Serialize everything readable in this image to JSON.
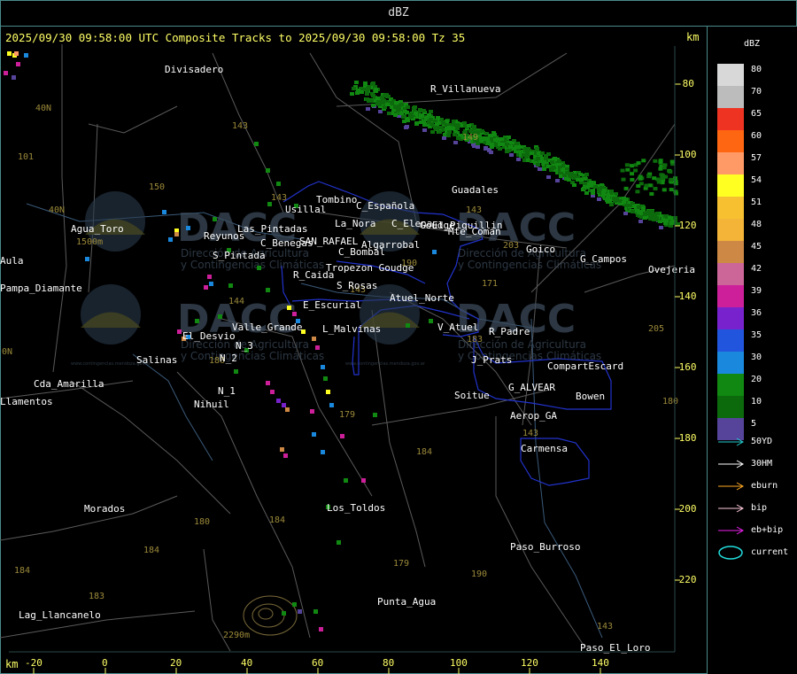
{
  "window": {
    "title": "dBZ"
  },
  "map": {
    "title": "2025/09/30 09:58:00 UTC Composite Tracks to 2025/09/30 09:58:00 Tz 35",
    "unit_top": "km",
    "unit_bottom": "km",
    "x_ticks": [
      "-20",
      "0",
      "20",
      "40",
      "60",
      "80",
      "100",
      "120",
      "140"
    ],
    "y_ticks": [
      "-80",
      "-100",
      "-120",
      "-140",
      "-160",
      "-180",
      "-200",
      "-220"
    ],
    "places": [
      "Divisadero",
      "R_Villanueva",
      "Guadales",
      "Tombino",
      "Usillal",
      "C_Española",
      "La_Nora",
      "C_Elena",
      "Goudge",
      "El_Piquillin",
      "Mte_Coman",
      "Goico",
      "G_Campos",
      "Ovejeria",
      "Agua_Toro",
      "Reyunos",
      "Las_Pintadas",
      "S_Pintada",
      "C_Benegas",
      "SAN_RAFAEL",
      "Algarrobal",
      "C_Bombal",
      "Tropezon Goudge",
      "Aula",
      "Pampa_Diamante",
      "R_Caida",
      "S_Rosas",
      "Atuel_Norte",
      "E_Escurial",
      "Valle_Grande",
      "L_Malvinas",
      "V_Atuel",
      "R_Padre",
      "El_Desvio",
      "Salinas",
      "N_2",
      "N_3",
      "J_Prats",
      "CompartEscard",
      "Cda_Amarilla",
      "N_1",
      "G_ALVEAR",
      "Soitue",
      "Bowen",
      "Nihuil",
      "Aerop_GA",
      "Carmensa",
      "Morados",
      "Los_Toldos",
      "Paso_Burroso",
      "Punta_Agua",
      "Lag_Llancanelo",
      "Paso_El_Loro",
      "Llamentos"
    ],
    "elevations": [
      "143",
      "150",
      "149",
      "143",
      "143",
      "203",
      "171",
      "143",
      "101",
      "40N",
      "40N",
      "144",
      "180",
      "184",
      "179",
      "184",
      "180",
      "190",
      "184",
      "183",
      "179",
      "190",
      "143",
      "205",
      "183",
      "2290m",
      "1500m",
      "0N"
    ],
    "watermark": {
      "brand": "DACC",
      "line1": "Dirección de Agricultura",
      "line2": "y Contingencias Climáticas",
      "url": "www.contingencias.mendoza.gov.ar"
    }
  },
  "legend": {
    "title": "dBZ",
    "levels": [
      {
        "value": "80",
        "color": "#d8d8d8"
      },
      {
        "value": "70",
        "color": "#bcbcbc"
      },
      {
        "value": "65",
        "color": "#ee3322"
      },
      {
        "value": "60",
        "color": "#ff6611"
      },
      {
        "value": "57",
        "color": "#ff9966"
      },
      {
        "value": "54",
        "color": "#ffff22"
      },
      {
        "value": "51",
        "color": "#f6c030"
      },
      {
        "value": "48",
        "color": "#f4b438"
      },
      {
        "value": "45",
        "color": "#cc8844"
      },
      {
        "value": "42",
        "color": "#cc6699"
      },
      {
        "value": "39",
        "color": "#cc1f99"
      },
      {
        "value": "36",
        "color": "#7722cc"
      },
      {
        "value": "35",
        "color": "#2255dd"
      },
      {
        "value": "30",
        "color": "#1a88dd"
      },
      {
        "value": "20",
        "color": "#118811"
      },
      {
        "value": "10",
        "color": "#0c6a0c"
      },
      {
        "value": "5",
        "color": "#55449a"
      }
    ],
    "tracks": [
      {
        "label": "50YD",
        "color": "#22cccc"
      },
      {
        "label": "30HM",
        "color": "#ffffff"
      },
      {
        "label": "eburn",
        "color": "#ffaa22"
      },
      {
        "label": "bip",
        "color": "#ffccdd"
      },
      {
        "label": "eb+bip",
        "color": "#ee22ee"
      },
      {
        "label": "current",
        "color": "#22dddd"
      }
    ]
  }
}
